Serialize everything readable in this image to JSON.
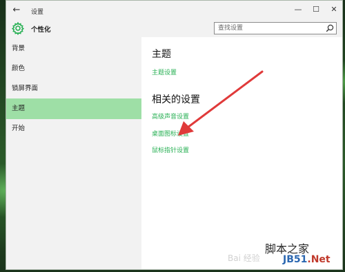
{
  "window": {
    "title": "设置",
    "back_icon": "back-arrow-icon",
    "minimize_icon": "minimize-icon",
    "maximize_icon": "maximize-icon",
    "close_icon": "close-icon"
  },
  "header": {
    "icon": "gear-icon",
    "title": "个性化",
    "search_placeholder": "查找设置"
  },
  "sidebar": {
    "items": [
      {
        "label": "背景",
        "active": false
      },
      {
        "label": "颜色",
        "active": false
      },
      {
        "label": "锁屏界面",
        "active": false
      },
      {
        "label": "主题",
        "active": true
      },
      {
        "label": "开始",
        "active": false
      }
    ]
  },
  "content": {
    "section1_heading": "主题",
    "section1_link": "主题设置",
    "section2_heading": "相关的设置",
    "related_links": [
      "高级声音设置",
      "桌面图标设置",
      "鼠标指针设置"
    ]
  },
  "watermark": {
    "top": "脚本之家",
    "site": "JB51",
    "tld": ".Net",
    "baidu": "Bai 经验"
  },
  "colors": {
    "accent": "#28b054",
    "active_nav": "#9edfa6",
    "arrow": "#e03a3a"
  }
}
